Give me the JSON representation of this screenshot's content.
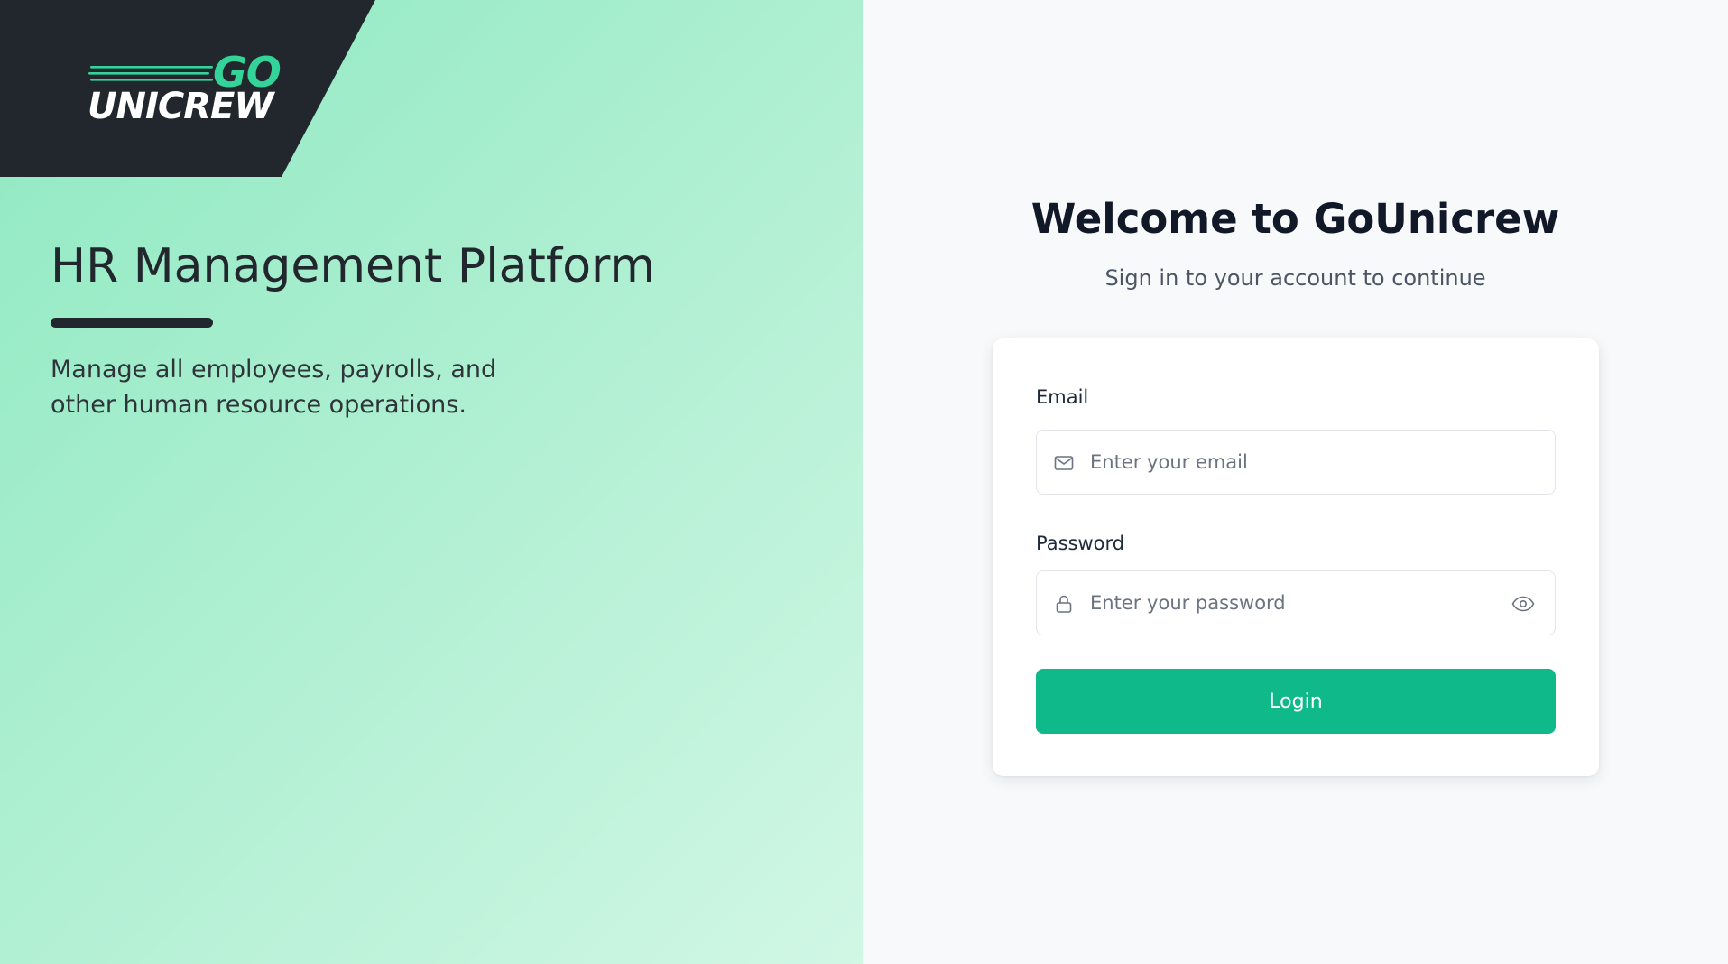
{
  "brand": {
    "logo_top": "GO",
    "logo_bottom": "UNICREW"
  },
  "hero": {
    "title": "HR Management Platform",
    "description": "Manage all employees, payrolls, and other human resource operations."
  },
  "login": {
    "heading": "Welcome to GoUnicrew",
    "subheading": "Sign in to your account to continue",
    "email_label": "Email",
    "email_placeholder": "Enter your email",
    "password_label": "Password",
    "password_placeholder": "Enter your password",
    "submit_label": "Login"
  },
  "icons": {
    "email": "mail-icon",
    "password": "lock-icon",
    "toggle_visibility": "eye-icon"
  },
  "colors": {
    "accent": "#10b98a",
    "logo_green": "#34d399",
    "dark": "#22272d",
    "panel_gradient_start": "#8ee9c1",
    "panel_gradient_end": "#d1f7e5"
  }
}
